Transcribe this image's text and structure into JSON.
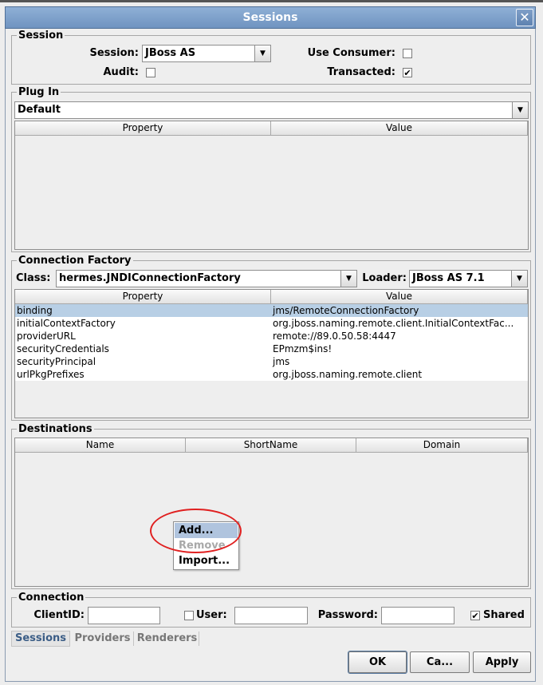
{
  "window": {
    "title": "Sessions",
    "close_glyph": "✕"
  },
  "session": {
    "title": "Session",
    "session_label": "Session:",
    "session_value": "JBoss AS",
    "use_consumer_label": "Use Consumer:",
    "audit_label": "Audit:",
    "transacted_label": "Transacted:",
    "use_consumer_checked": false,
    "audit_checked": false,
    "transacted_checked": true
  },
  "plugin": {
    "title": "Plug In",
    "value": "Default",
    "columns": [
      "Property",
      "Value"
    ]
  },
  "factory": {
    "title": "Connection Factory",
    "class_label": "Class:",
    "class_value": "hermes.JNDIConnectionFactory",
    "loader_label": "Loader:",
    "loader_value": "JBoss AS 7.1",
    "columns": [
      "Property",
      "Value"
    ],
    "rows": [
      [
        "binding",
        "jms/RemoteConnectionFactory"
      ],
      [
        "initialContextFactory",
        "org.jboss.naming.remote.client.InitialContextFac..."
      ],
      [
        "providerURL",
        "remote://89.0.50.58:4447"
      ],
      [
        "securityCredentials",
        "EPmzm$ins!"
      ],
      [
        "securityPrincipal",
        "jms"
      ],
      [
        "urlPkgPrefixes",
        "org.jboss.naming.remote.client"
      ]
    ]
  },
  "destinations": {
    "title": "Destinations",
    "columns": [
      "Name",
      "ShortName",
      "Domain"
    ],
    "menu": {
      "add": "Add...",
      "remove": "Remove",
      "import": "Import..."
    }
  },
  "connection": {
    "title": "Connection",
    "clientid_label": "ClientID:",
    "clientid_value": "",
    "user_label": "User:",
    "user_value": "",
    "password_label": "Password:",
    "password_value": "",
    "shared_label": "Shared",
    "user_checked": false,
    "shared_checked": true
  },
  "tabs": [
    "Sessions",
    "Providers",
    "Renderers"
  ],
  "buttons": {
    "ok": "OK",
    "cancel": "Ca...",
    "apply": "Apply"
  },
  "colors": {
    "titlebar": "#7396c2",
    "selection": "#b8cfe5",
    "highlight_circle": "#e02020"
  }
}
